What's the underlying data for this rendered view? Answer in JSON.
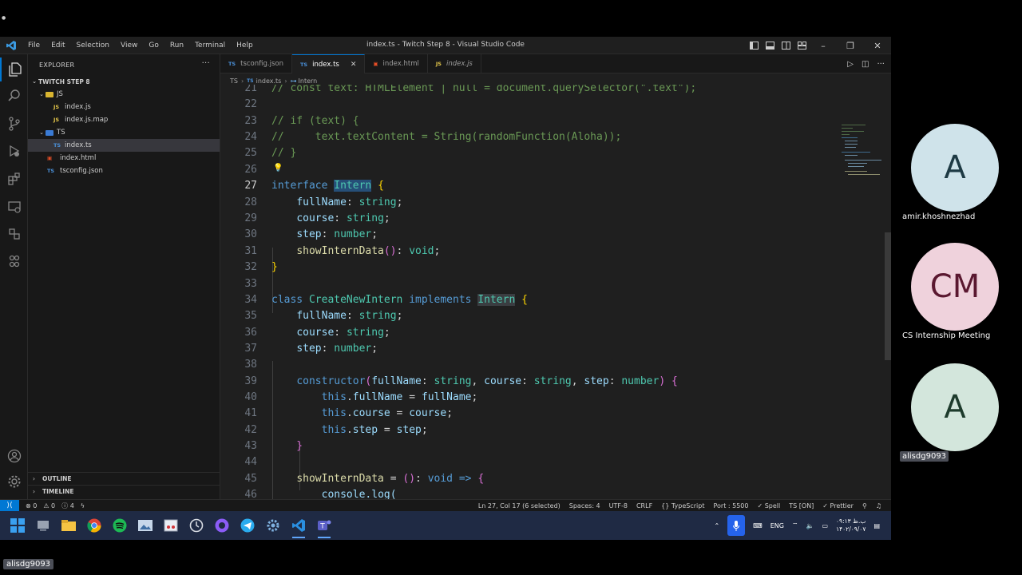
{
  "window": {
    "title": "index.ts - Twitch Step 8 - Visual Studio Code",
    "menu": [
      "File",
      "Edit",
      "Selection",
      "View",
      "Go",
      "Run",
      "Terminal",
      "Help"
    ]
  },
  "explorer": {
    "header": "EXPLORER",
    "more": "···",
    "root": "TWITCH STEP 8",
    "items": [
      {
        "label": "JS",
        "type": "folder",
        "indent": 1,
        "icon": "JS"
      },
      {
        "label": "index.js",
        "type": "file",
        "indent": 2,
        "icon": "JS"
      },
      {
        "label": "index.js.map",
        "type": "file",
        "indent": 2,
        "icon": "JS"
      },
      {
        "label": "TS",
        "type": "folder",
        "indent": 1,
        "icon": "TS"
      },
      {
        "label": "index.ts",
        "type": "file",
        "indent": 2,
        "icon": "TS",
        "selected": true
      },
      {
        "label": "index.html",
        "type": "file",
        "indent": 1,
        "icon": "html"
      },
      {
        "label": "tsconfig.json",
        "type": "file",
        "indent": 1,
        "icon": "TS"
      }
    ],
    "outline": "OUTLINE",
    "timeline": "TIMELINE"
  },
  "tabs": [
    {
      "label": "tsconfig.json",
      "icon": "TS",
      "active": false
    },
    {
      "label": "index.ts",
      "icon": "TS",
      "active": true
    },
    {
      "label": "index.html",
      "icon": "html",
      "active": false
    },
    {
      "label": "index.js",
      "icon": "JS",
      "active": false
    }
  ],
  "breadcrumb": [
    "TS",
    "index.ts",
    "Intern"
  ],
  "code": {
    "lines": [
      "21",
      "22",
      "23",
      "24",
      "25",
      "26",
      "27",
      "28",
      "29",
      "30",
      "31",
      "32",
      "33",
      "34",
      "35",
      "36",
      "37",
      "38",
      "39",
      "40",
      "41",
      "42",
      "43",
      "44",
      "45",
      "46"
    ],
    "current_line": "27",
    "text": {
      "l21": "// const text: HTMLElement | null = document.querySelector(\".text\");",
      "l23": "// if (text) {",
      "l24": "//     text.textContent = String(randomFunction(Aloha));",
      "l25": "// }",
      "kw_interface": "interface",
      "kw_class": "class",
      "kw_implements": "implements",
      "kw_this": "this",
      "kw_constructor": "constructor",
      "kw_void": "void",
      "name_intern": "Intern",
      "name_create": "CreateNewIntern",
      "p_fullName": "fullName",
      "p_course": "course",
      "p_step": "step",
      "fn_show": "showInternData",
      "t_string": "string",
      "t_number": "number",
      "l46": "console.log("
    }
  },
  "statusbar": {
    "remote": "⟩⟨",
    "errors": "⊗ 0",
    "warnings": "⚠ 0",
    "info": "ⓘ 4",
    "position": "Ln 27, Col 17 (6 selected)",
    "spaces": "Spaces: 4",
    "encoding": "UTF-8",
    "eol": "CRLF",
    "language": "{} TypeScript",
    "port": "Port : 5500",
    "spell": "✓ Spell",
    "ts": "TS [ON]",
    "prettier": "✓ Prettier"
  },
  "taskbar": {
    "lang": "ENG",
    "time": "۰۹:۱۳ ب.ظ",
    "date": "۱۴۰۲/۰۹/۰۷"
  },
  "participants": [
    {
      "initials": "A",
      "name": "amir.khoshnezhad",
      "bg": "#cfe3ea",
      "fg": "#1e3a44"
    },
    {
      "initials": "CM",
      "name": "CS Internship Meeting",
      "bg": "#efd2dc",
      "fg": "#5a1830"
    },
    {
      "initials": "A",
      "name": "alisdg9093",
      "bg": "#d3e6dc",
      "fg": "#1d3b2c"
    }
  ],
  "bottom_label": "alisdg9093",
  "colors": {
    "accent": "#0078d4",
    "editor_bg": "#1f1f1f",
    "selection": "#264f78"
  }
}
